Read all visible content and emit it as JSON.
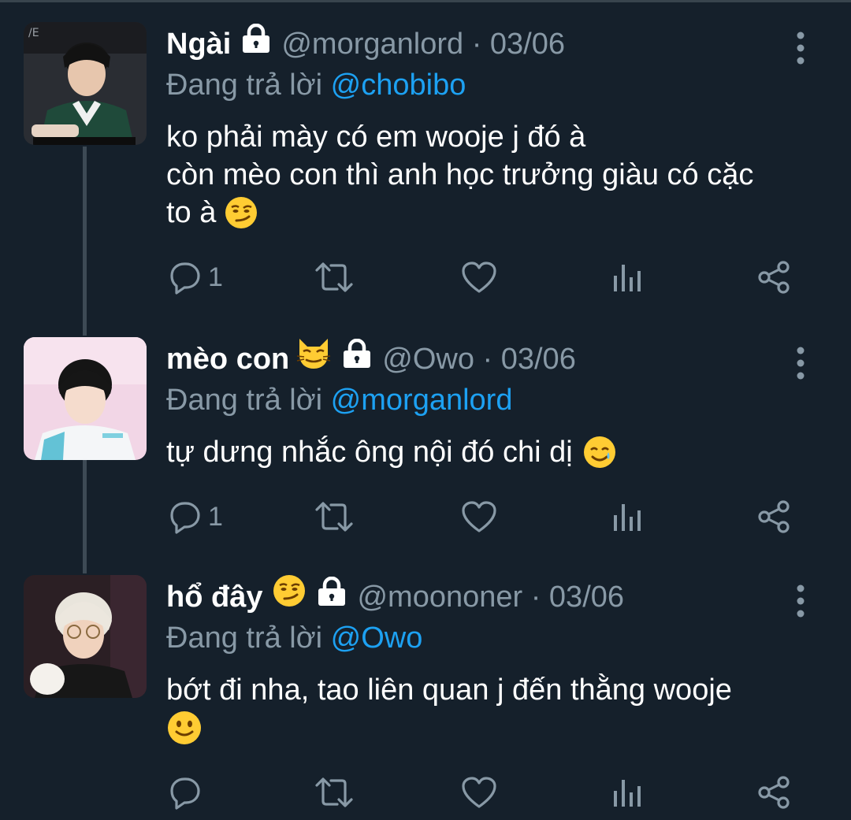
{
  "tweets": [
    {
      "name": "Ngài",
      "name_emoji": "",
      "handle_date": "@morganlord · 03/06",
      "reply_prefix": "Đang trả lời",
      "reply_to": "@chobibo",
      "body_lines": [
        "ko phải mày có em wooje j đó à",
        "còn mèo con thì anh học trưởng giàu có cặc",
        "to à"
      ],
      "body_emoji": "smirk-emoji",
      "reply_count": "1"
    },
    {
      "name": "mèo con",
      "name_emoji": "cat-emoji",
      "handle_date": "@Owo · 03/06",
      "reply_prefix": "Đang trả lời",
      "reply_to": "@morganlord",
      "body_lines": [
        "tự dưng nhắc ông nội đó chi dị"
      ],
      "body_emoji": "smiling-tear-emoji",
      "reply_count": "1"
    },
    {
      "name": "hổ đây",
      "name_emoji": "smirk-emoji",
      "handle_date": "@moononer · 03/06",
      "reply_prefix": "Đang trả lời",
      "reply_to": "@Owo",
      "body_lines": [
        "bớt đi nha, tao liên quan j đến thằng wooje",
        ""
      ],
      "body_emoji": "slight-smile-emoji",
      "reply_count": ""
    }
  ],
  "colors": {
    "background": "#15202b",
    "text_primary": "#ffffff",
    "text_secondary": "#8899a6",
    "mention": "#1da1f2",
    "thread_line": "#3d4a55"
  }
}
